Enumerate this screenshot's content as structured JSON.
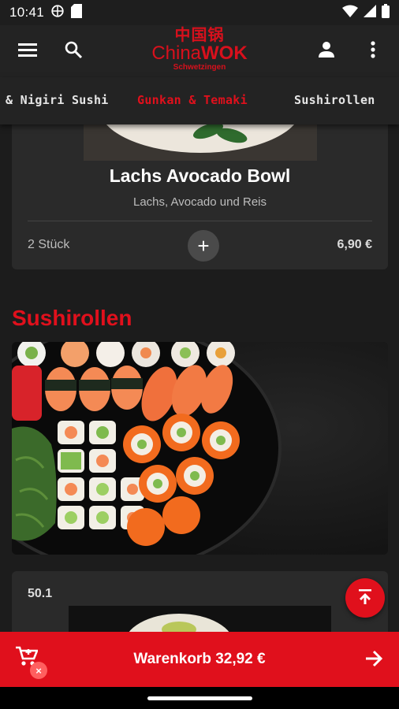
{
  "status_bar": {
    "time": "10:41",
    "left_icons": [
      "vpn-icon",
      "sim-icon"
    ],
    "right_icons": [
      "wifi-icon",
      "signal-icon",
      "battery-icon"
    ]
  },
  "app_bar": {
    "logo_chinese": "中国锅",
    "logo_brand_light": "China",
    "logo_brand_bold": "WOK",
    "logo_city": "Schwetzingen",
    "accent_color": "#e0101c"
  },
  "tabs": [
    {
      "label": "& Nigiri Sushi",
      "active": false
    },
    {
      "label": "Gunkan & Temaki",
      "active": true
    },
    {
      "label": "Sushirollen",
      "active": false
    }
  ],
  "product": {
    "title": "Lachs Avocado Bowl",
    "description": "Lachs, Avocado und Reis",
    "quantity": "2 Stück",
    "add_symbol": "+",
    "price": "6,90 €"
  },
  "section": {
    "heading": "Sushirollen"
  },
  "next_product": {
    "number": "50.1"
  },
  "cart": {
    "label": "Warenkorb 32,92 €",
    "badge": "×"
  }
}
